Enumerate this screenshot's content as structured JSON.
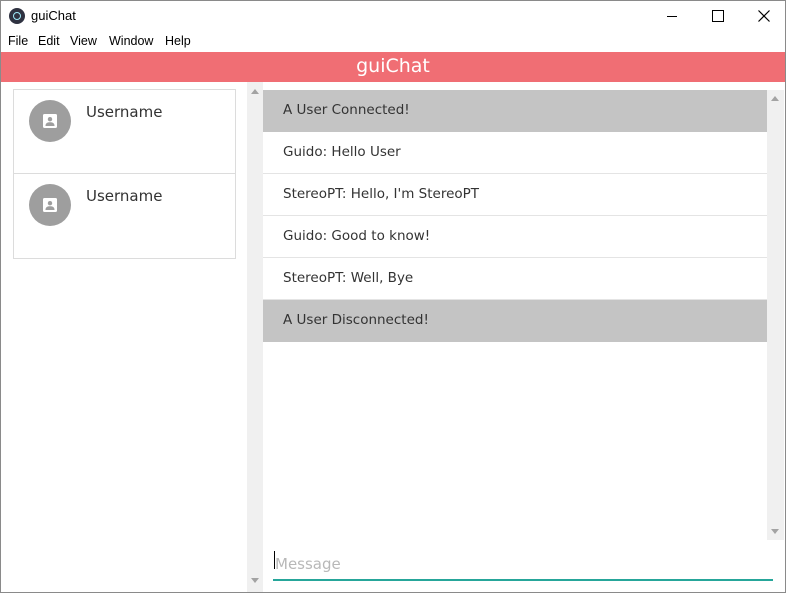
{
  "window": {
    "title": "guiChat",
    "icon": "electron-app-icon"
  },
  "menu": {
    "items": [
      "File",
      "Edit",
      "View",
      "Window",
      "Help"
    ]
  },
  "header": {
    "title": "guiChat",
    "color": "#f06e74"
  },
  "users": [
    {
      "name": "Username",
      "icon": "account-box-icon"
    },
    {
      "name": "Username",
      "icon": "account-box-icon"
    }
  ],
  "messages": [
    {
      "text": "A User Connected!",
      "kind": "system"
    },
    {
      "text": "Guido: Hello User",
      "kind": "chat"
    },
    {
      "text": "StereoPT: Hello, I'm StereoPT",
      "kind": "chat"
    },
    {
      "text": "Guido: Good to know!",
      "kind": "chat"
    },
    {
      "text": "StereoPT: Well, Bye",
      "kind": "chat"
    },
    {
      "text": "A User Disconnected!",
      "kind": "system"
    }
  ],
  "input": {
    "placeholder": "Message",
    "value": "",
    "accent_color": "#26a69a"
  },
  "colors": {
    "system_message_bg": "#c4c4c4",
    "avatar_bg": "#9e9e9e"
  }
}
